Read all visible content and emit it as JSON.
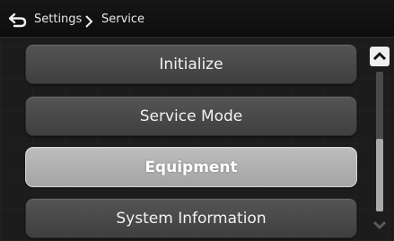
{
  "header": {
    "back_icon": "back-arrow-icon",
    "breadcrumb": [
      "Settings",
      "Service"
    ],
    "separator_icon": "chevron-right-icon"
  },
  "menu": {
    "items": [
      {
        "label": "Initialize",
        "selected": false
      },
      {
        "label": "Service Mode",
        "selected": false
      },
      {
        "label": "Equipment",
        "selected": true
      },
      {
        "label": "System Information",
        "selected": false
      }
    ]
  },
  "scrollbar": {
    "up_icon": "chevron-up-icon",
    "down_icon": "chevron-down-icon",
    "down_enabled": false,
    "thumb_start_fraction": 0.48,
    "thumb_end_fraction": 1.0
  }
}
